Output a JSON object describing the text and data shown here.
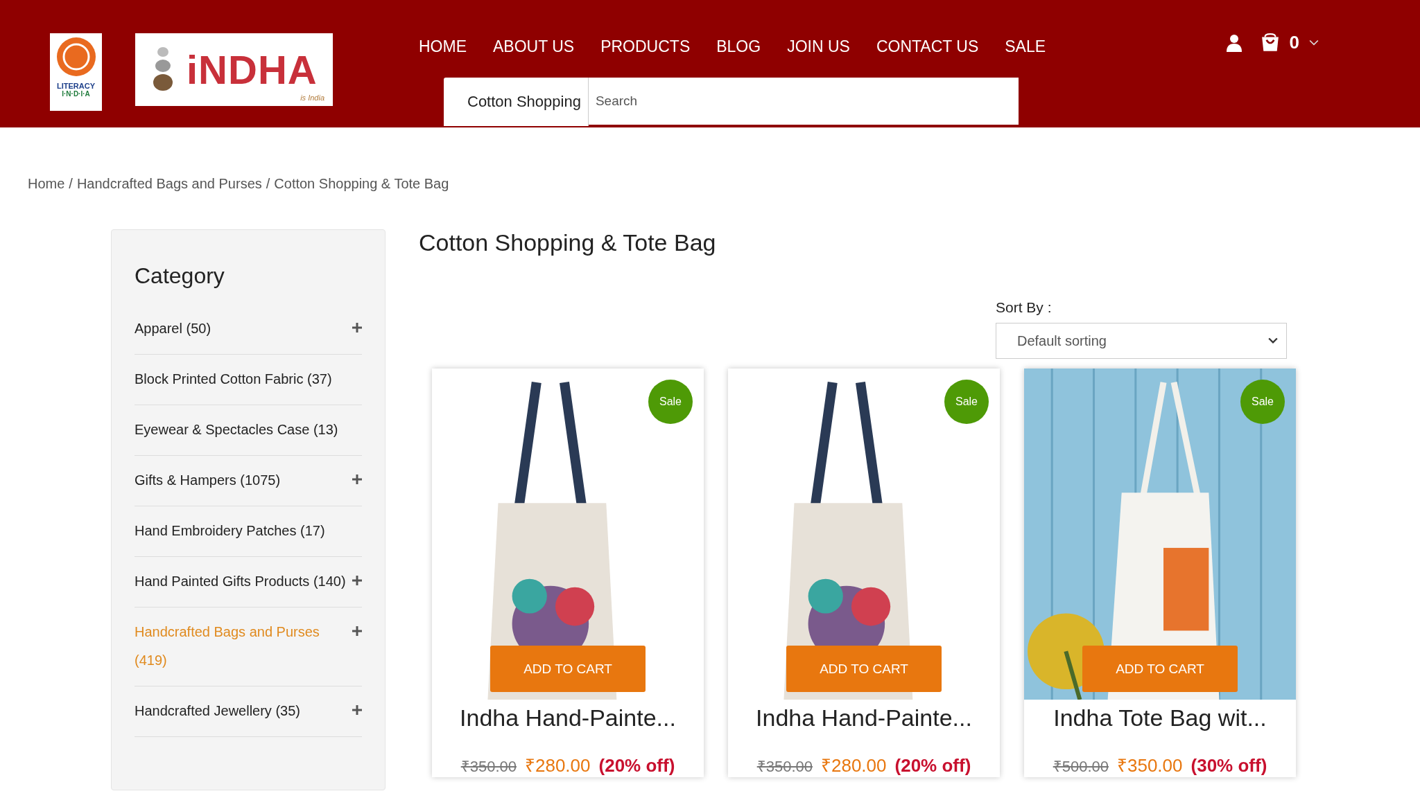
{
  "header": {
    "literacy_logo": {
      "text": "LITERACY",
      "subtext": "I·N·D·I·A"
    },
    "brand_logo": {
      "text": "iNDHA",
      "tagline": "is India"
    },
    "nav": [
      "HOME",
      "ABOUT US",
      "PRODUCTS",
      "BLOG",
      "JOIN US",
      "CONTACT US",
      "SALE"
    ],
    "search": {
      "category": "Cotton Shopping",
      "placeholder": "Search"
    },
    "cart": {
      "count": "0"
    }
  },
  "breadcrumb": {
    "separator": "/",
    "items": [
      "Home",
      "Handcrafted Bags and Purses",
      "Cotton Shopping & Tote Bag"
    ]
  },
  "sidebar": {
    "title": "Category",
    "items": [
      {
        "label": "Apparel (50)",
        "expandable": true,
        "selected": false
      },
      {
        "label": "Block Printed Cotton Fabric (37)",
        "expandable": false,
        "selected": false
      },
      {
        "label": "Eyewear & Spectacles Case (13)",
        "expandable": false,
        "selected": false
      },
      {
        "label": "Gifts & Hampers (1075)",
        "expandable": true,
        "selected": false
      },
      {
        "label": "Hand Embroidery Patches (17)",
        "expandable": false,
        "selected": false
      },
      {
        "label": "Hand Painted Gifts Products (140)",
        "expandable": true,
        "selected": false
      },
      {
        "label": "Handcrafted Bags and Purses (419)",
        "expandable": true,
        "selected": true
      },
      {
        "label": "Handcrafted Jewellery (35)",
        "expandable": true,
        "selected": false
      }
    ]
  },
  "page_title": "Cotton Shopping & Tote Bag",
  "sort": {
    "label": "Sort By :",
    "value": "Default sorting"
  },
  "products": [
    {
      "kind": "studio",
      "badge": "Sale",
      "button": "ADD TO CART",
      "name": "Indha Hand-Painte...",
      "old_price": "₹350.00",
      "price": "₹280.00",
      "discount": "(20% off)"
    },
    {
      "kind": "studio",
      "badge": "Sale",
      "button": "ADD TO CART",
      "name": "Indha Hand-Painte...",
      "old_price": "₹350.00",
      "price": "₹280.00",
      "discount": "(20% off)"
    },
    {
      "kind": "wall",
      "badge": "Sale",
      "button": "ADD TO CART",
      "name": "Indha Tote Bag wit...",
      "old_price": "₹500.00",
      "price": "₹350.00",
      "discount": "(30% off)"
    }
  ]
}
